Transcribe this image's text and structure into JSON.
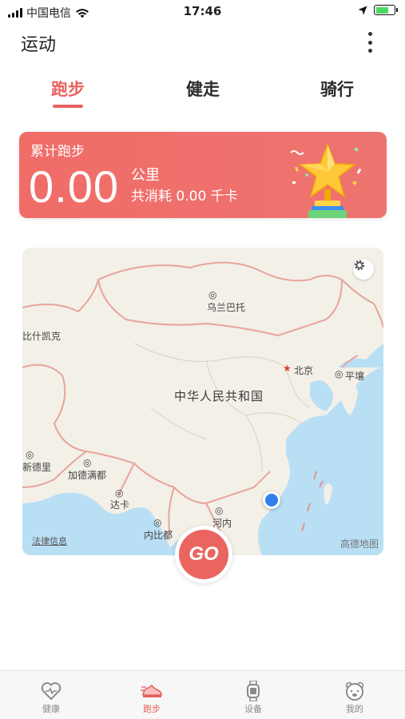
{
  "status_bar": {
    "carrier": "中国电信",
    "time": "17:46"
  },
  "header": {
    "title": "运动",
    "more_icon": "more-vertical-icon"
  },
  "tabs": [
    {
      "label": "跑步",
      "active": true
    },
    {
      "label": "健走",
      "active": false
    },
    {
      "label": "骑行",
      "active": false
    }
  ],
  "stats": {
    "title": "累计跑步",
    "distance": "0.00",
    "unit": "公里",
    "calories_text": "共消耗 0.00 千卡",
    "icon": "trophy-icon"
  },
  "map": {
    "labels": {
      "ulaanbaatar": "乌兰巴托",
      "bishkek": "比什凯克",
      "beijing": "北京",
      "pyongyang": "平壤",
      "china": "中华人民共和国",
      "new_delhi": "新德里",
      "kathmandu": "加德满都",
      "dhaka": "达卡",
      "hanoi": "河内",
      "naypyidaw": "内比都"
    },
    "legal": "法律信息",
    "attribution": "高德地图",
    "settings_icon": "gear-icon"
  },
  "go_button": {
    "label": "GO"
  },
  "bottom_nav": [
    {
      "label": "健康",
      "icon": "heart-icon",
      "active": false
    },
    {
      "label": "跑步",
      "icon": "running-shoe-icon",
      "active": true
    },
    {
      "label": "设备",
      "icon": "watch-icon",
      "active": false
    },
    {
      "label": "我的",
      "icon": "bear-face-icon",
      "active": false
    }
  ],
  "colors": {
    "accent": "#e8625f",
    "card": "#ee6e6a",
    "location": "#2f7ff0"
  }
}
